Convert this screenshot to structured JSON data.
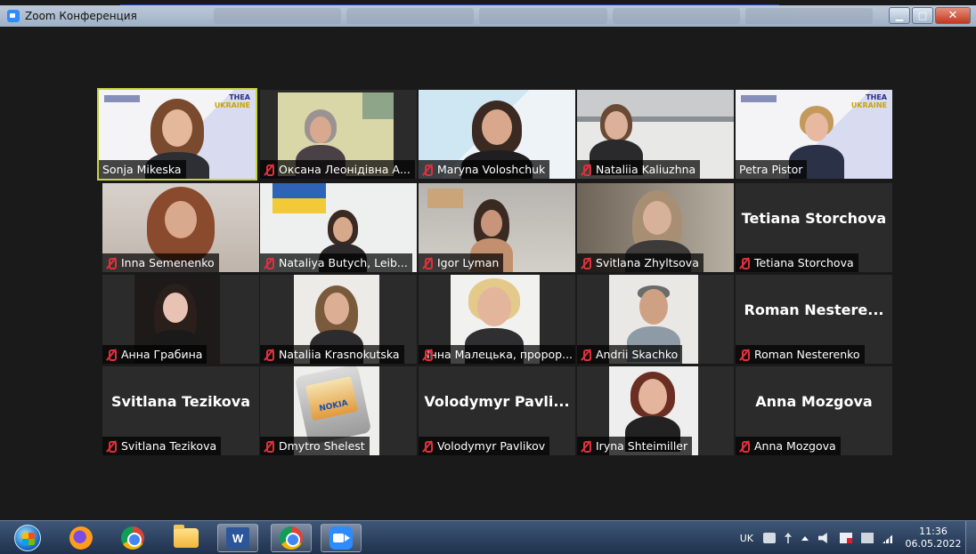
{
  "window": {
    "title": "Zoom Конференция",
    "minimize_glyph": "▁",
    "maximize_glyph": "□",
    "close_glyph": "✕"
  },
  "colors": {
    "background": "#1a1a1a",
    "active_speaker_border": "#c6d43d",
    "muted_mic": "#e0303a",
    "label_bg": "rgba(0,0,0,0.72)"
  },
  "participants": [
    {
      "name": "Sonja Mikeska",
      "muted": false,
      "active": true,
      "video": true
    },
    {
      "name": "Оксана Леонідівна А...",
      "muted": true,
      "video": true
    },
    {
      "name": "Maryna Voloshchuk",
      "muted": true,
      "video": true
    },
    {
      "name": "Nataliia Kaliuzhna",
      "muted": true,
      "video": true
    },
    {
      "name": "Petra Pistor",
      "muted": false,
      "video": true
    },
    {
      "name": "Inna Semenenko",
      "muted": true,
      "video": true
    },
    {
      "name": "Nataliya Butych, Leib...",
      "muted": true,
      "video": true
    },
    {
      "name": "Igor Lyman",
      "muted": true,
      "video": true
    },
    {
      "name": "Svitlana Zhyltsova",
      "muted": true,
      "video": true
    },
    {
      "name": "Tetiana Storchova",
      "muted": true,
      "video": false,
      "display_name": "Tetiana Storchova"
    },
    {
      "name": "Анна Грабина",
      "muted": true,
      "video": true
    },
    {
      "name": "Nataliia Krasnokutska",
      "muted": true,
      "video": true
    },
    {
      "name": "Інна Малецька, пророр...",
      "muted": true,
      "video": true
    },
    {
      "name": "Andrii Skachko",
      "muted": true,
      "video": true
    },
    {
      "name": "Roman Nesterenko",
      "muted": true,
      "video": false,
      "display_name": "Roman Nestere..."
    },
    {
      "name": "Svitlana Tezikova",
      "muted": true,
      "video": false,
      "display_name": "Svitlana Tezikova"
    },
    {
      "name": "Dmytro Shelest",
      "muted": true,
      "video": true
    },
    {
      "name": "Volodymyr Pavlikov",
      "muted": true,
      "video": false,
      "display_name": "Volodymyr Pavli..."
    },
    {
      "name": "Iryna Shteimiller",
      "muted": true,
      "video": true
    },
    {
      "name": "Anna Mozgova",
      "muted": true,
      "video": false,
      "display_name": "Anna Mozgova"
    }
  ],
  "slides": {
    "thea_label": "THEA",
    "ukraine_label": "UKRAINE",
    "nokia_label": "NOKIA"
  },
  "taskbar": {
    "apps": [
      "start-button",
      "firefox",
      "chrome",
      "file-explorer",
      "word",
      "chrome-active",
      "zoom"
    ],
    "word_glyph": "W",
    "language": "UK",
    "time": "11:36",
    "date": "06.05.2022"
  }
}
